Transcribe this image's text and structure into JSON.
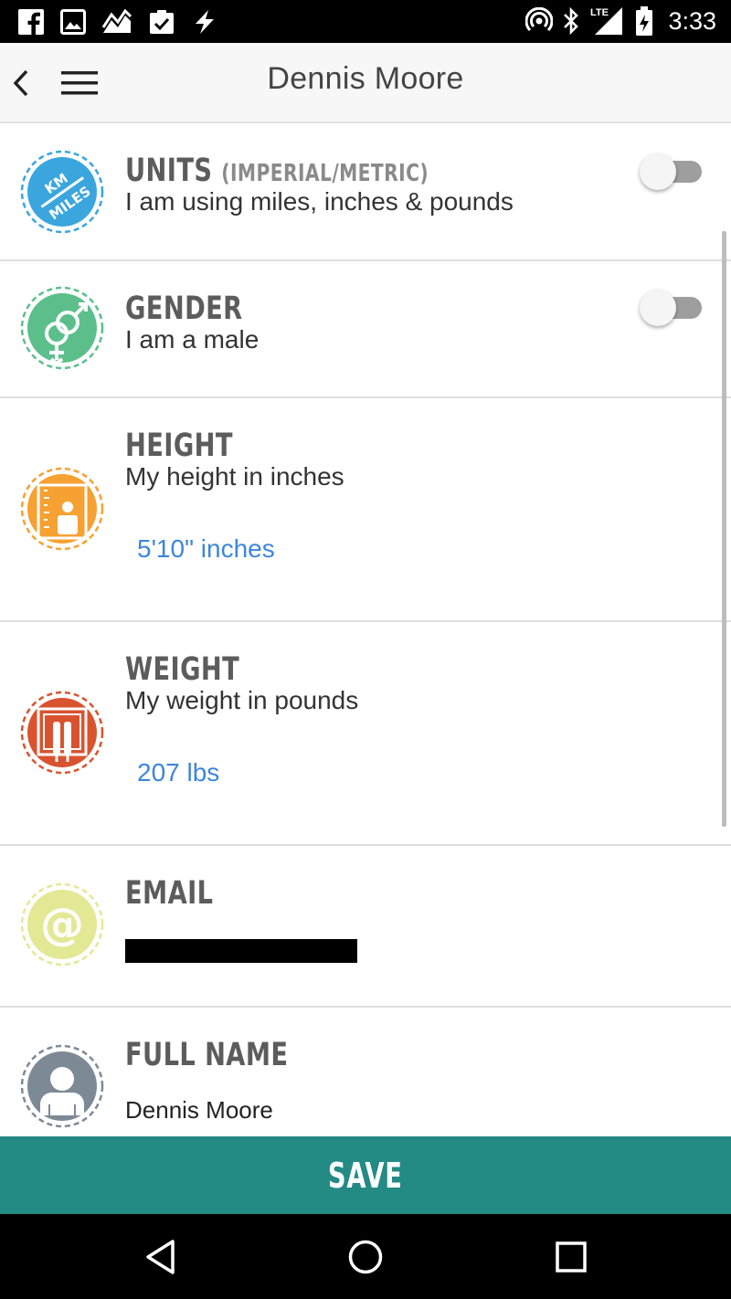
{
  "status_bar": {
    "time": "3:33",
    "network": "LTE",
    "icons": [
      "facebook-icon",
      "image-icon",
      "trend-icon",
      "clipboard-check-icon",
      "flash-icon",
      "hotspot-icon",
      "bluetooth-icon",
      "signal-icon",
      "battery-icon"
    ]
  },
  "header": {
    "title": "Dennis Moore",
    "back_icon": "chevron-left-icon",
    "menu_icon": "hamburger-menu-icon"
  },
  "settings": {
    "units": {
      "label": "UNITS",
      "sublabel": "(IMPERIAL/METRIC)",
      "description": "I am using miles, inches & pounds",
      "icon_text_top": "KM",
      "icon_text_bottom": "MILES",
      "icon_color": "#3aa6dd",
      "toggle_on": false
    },
    "gender": {
      "label": "GENDER",
      "description": "I am a male",
      "icon_color": "#5cbf8b",
      "toggle_on": false
    },
    "height": {
      "label": "HEIGHT",
      "description": "My height in inches",
      "value": "5'10\" inches",
      "icon_color": "#f6a132"
    },
    "weight": {
      "label": "WEIGHT",
      "description": "My weight in pounds",
      "value": "207 lbs",
      "icon_color": "#d9532f"
    },
    "email": {
      "label": "EMAIL",
      "icon_glyph": "@",
      "icon_color": "#e3e895"
    },
    "full_name": {
      "label": "FULL NAME",
      "value": "Dennis Moore",
      "icon_color": "#7d8a96"
    }
  },
  "save_button": {
    "label": "SAVE",
    "color": "#248a84"
  },
  "nav_bar": {
    "back_icon": "triangle-back-icon",
    "home_icon": "circle-home-icon",
    "recents_icon": "square-recents-icon"
  },
  "colors": {
    "value_text": "#3d86db",
    "label_text": "#5c5c5c"
  }
}
